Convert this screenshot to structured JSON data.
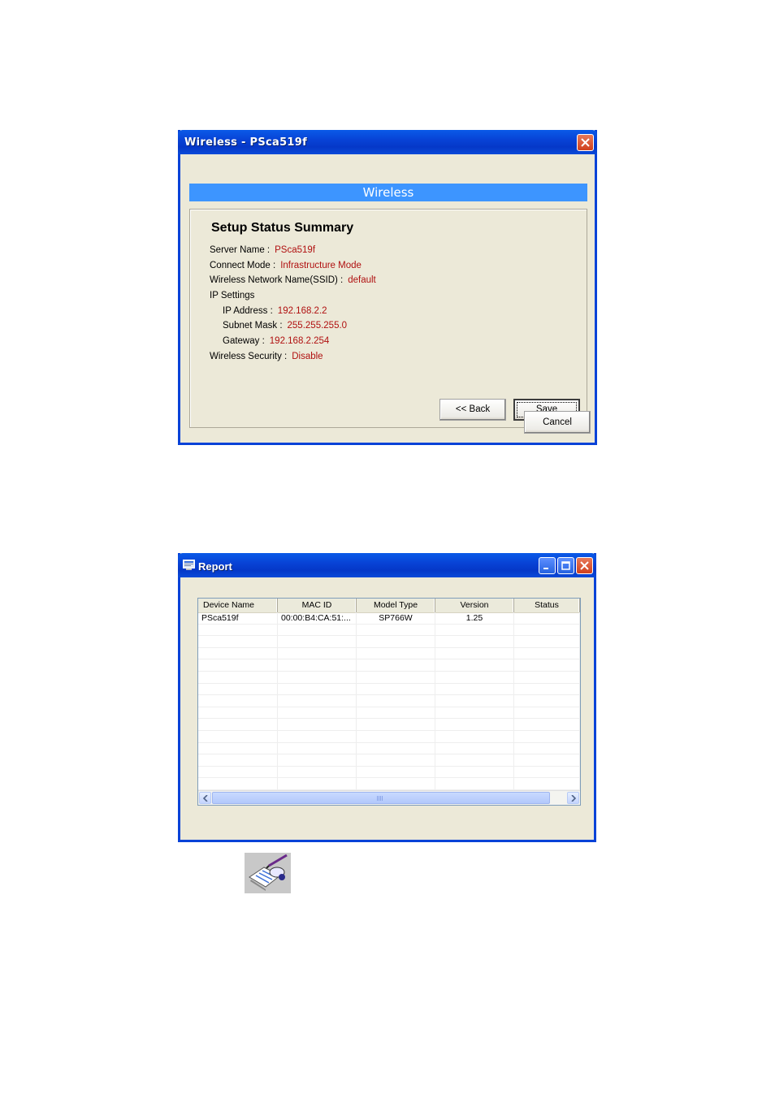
{
  "wireless_window": {
    "title": "Wireless - PSca519f",
    "banner": "Wireless",
    "summary_title": "Setup Status Summary",
    "fields": [
      {
        "label": "Server Name :",
        "value": "PSca519f"
      },
      {
        "label": "Connect Mode :",
        "value": "Infrastructure Mode"
      },
      {
        "label": "Wireless Network Name(SSID) :",
        "value": "default"
      },
      {
        "label": "IP Settings",
        "value": ""
      },
      {
        "label": "IP Address :",
        "value": "192.168.2.2"
      },
      {
        "label": "Subnet Mask :",
        "value": "255.255.255.0"
      },
      {
        "label": "Gateway :",
        "value": "192.168.2.254"
      },
      {
        "label": "Wireless Security :",
        "value": "Disable"
      }
    ],
    "back_label": "<< Back",
    "save_label": "Save",
    "cancel_label": "Cancel"
  },
  "report_window": {
    "title": "Report",
    "columns": [
      "Device Name",
      "MAC ID",
      "Model Type",
      "Version",
      "Status"
    ],
    "rows": [
      [
        "PSca519f",
        "00:00:B4:CA:51:...",
        "SP766W",
        "1.25",
        ""
      ]
    ]
  },
  "toolbar_icon": "edit-wizard-icon"
}
